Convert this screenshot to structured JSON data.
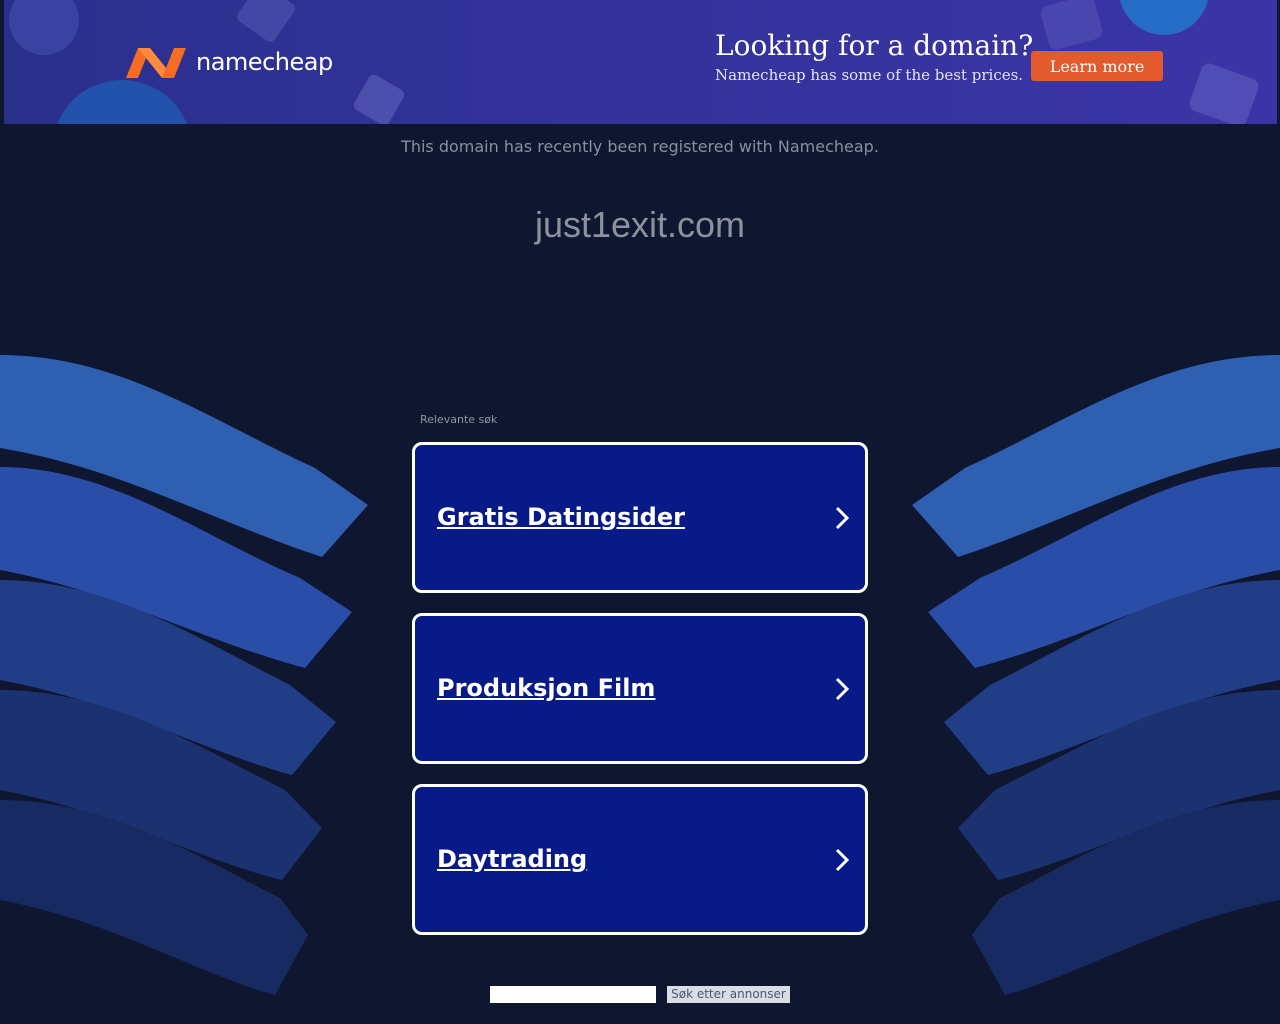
{
  "banner": {
    "brand": "namecheap",
    "title": "Looking for a domain?",
    "subtitle": "Namecheap has some of the best prices.",
    "cta_label": "Learn more"
  },
  "notice": "This domain has recently been registered with Namecheap.",
  "domain": "just1exit.com",
  "related": {
    "label": "Relevante søk",
    "items": [
      {
        "label": "Gratis Datingsider"
      },
      {
        "label": "Produksjon Film"
      },
      {
        "label": "Daytrading"
      }
    ]
  },
  "search": {
    "input_value": "",
    "button_label": "Søk etter annonser"
  },
  "colors": {
    "background": "#0f1730",
    "banner": "#33339a",
    "cta": "#e35a2c",
    "card": "#081a87",
    "logo_orange": "#f56d25"
  }
}
